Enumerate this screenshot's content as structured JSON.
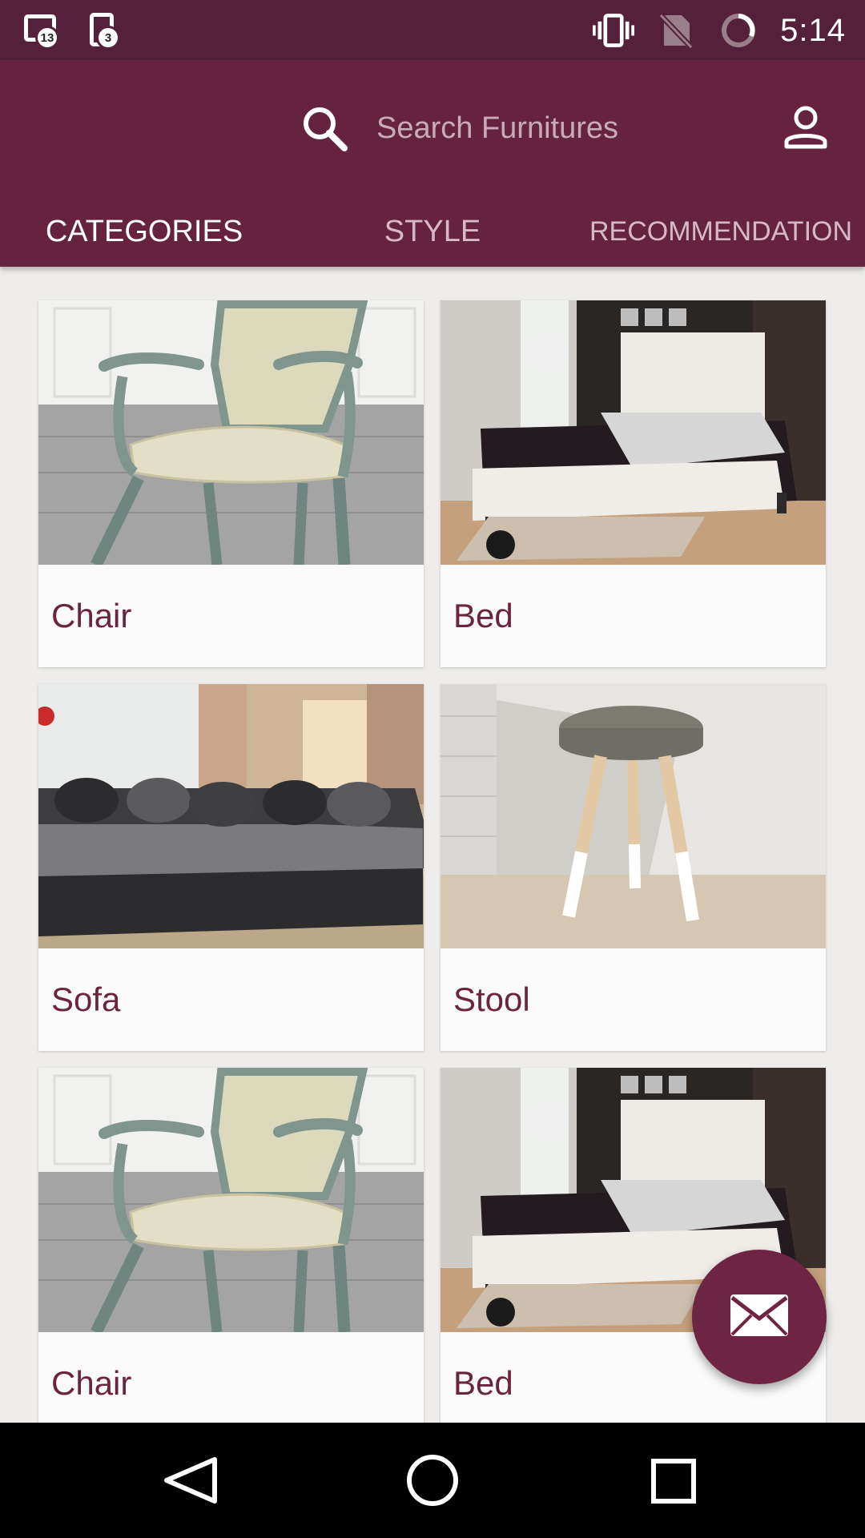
{
  "status_bar": {
    "time": "5:14",
    "notifications": [
      {
        "icon": "calendar-notification-icon",
        "badge": "13"
      },
      {
        "icon": "message-notification-icon",
        "badge": "3"
      }
    ],
    "icons": [
      "vibrate-icon",
      "no-sim-icon",
      "loading-ring-icon"
    ]
  },
  "header": {
    "search_placeholder": "Search Furnitures",
    "tabs": [
      {
        "label": "CATEGORIES",
        "active": true
      },
      {
        "label": "STYLE",
        "active": false
      },
      {
        "label": "RECOMMENDATION",
        "active": false
      }
    ]
  },
  "categories": [
    {
      "label": "Chair",
      "image": "chair"
    },
    {
      "label": "Bed",
      "image": "bed"
    },
    {
      "label": "Sofa",
      "image": "sofa"
    },
    {
      "label": "Stool",
      "image": "stool"
    },
    {
      "label": "Chair",
      "image": "chair"
    },
    {
      "label": "Bed",
      "image": "bed"
    }
  ],
  "fab": {
    "icon": "mail-icon"
  },
  "nav": {
    "icons": [
      "back-icon",
      "home-icon",
      "recents-icon"
    ]
  },
  "colors": {
    "status_bar": "#55213a",
    "app_bar": "#66233f",
    "accent": "#6d2543",
    "label_text": "#6a2440",
    "background": "#eeedeb"
  }
}
